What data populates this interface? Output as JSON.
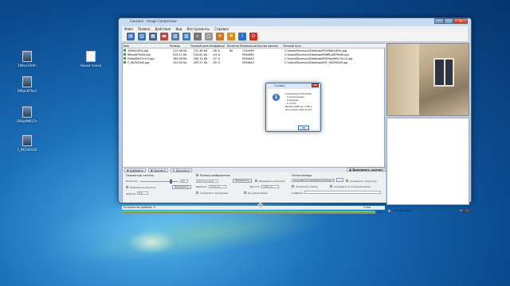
{
  "window": {
    "title": "Caesium - Image Compressor",
    "min_label": "–",
    "max_label": "□",
    "close_label": "✕"
  },
  "menu": [
    "Файл",
    "Правка",
    "Действие",
    "Вид",
    "Инструменты",
    "Справка"
  ],
  "toolbar_icons": [
    {
      "name": "open-icon",
      "color": "#3d6fb6",
      "glyph": "▤"
    },
    {
      "name": "folder-icon",
      "color": "#3d6fb6",
      "glyph": "▥"
    },
    {
      "name": "save-icon",
      "color": "#4a5f87",
      "glyph": "▦"
    },
    {
      "name": "remove-icon",
      "color": "#b94a48",
      "glyph": "▬"
    },
    {
      "name": "clear-icon",
      "color": "#5577aa",
      "glyph": "▧"
    },
    {
      "name": "export-icon",
      "color": "#3b7bbd",
      "glyph": "▨"
    },
    {
      "name": "search-icon",
      "color": "#777777",
      "glyph": "⌕"
    },
    {
      "name": "preview-icon",
      "color": "#999999",
      "glyph": "◻"
    },
    {
      "name": "tools-icon",
      "color": "#c27a2a",
      "glyph": "✕"
    },
    {
      "name": "gear-icon",
      "color": "#d88a1a",
      "glyph": "✲"
    },
    {
      "name": "info-icon",
      "color": "#2f6fc3",
      "glyph": "i"
    },
    {
      "name": "power-icon",
      "color": "#cc3322",
      "glyph": "⏻"
    }
  ],
  "table": {
    "headers": [
      "Имя",
      "Размер",
      "Полный разм",
      "Коэффици",
      "Качество",
      "Разрешение",
      "Кол-во цветов",
      "Полный путь"
    ],
    "rows": [
      {
        "name": "1Mike1St9n.jpg",
        "size": "213.06 Kb",
        "new": "131.36 Kb",
        "ratio": "-38 %",
        "q": "80",
        "res": "720x959",
        "colors": "",
        "path": "C:\\Users\\Roumuck\\Desktop\\fff\\1Mike1St9n.jpg"
      },
      {
        "name": "6fftyk87fksf0.jpg",
        "size": "414.11 Kb",
        "new": "233.81 Kb",
        "ratio": "-44 %",
        "q": "",
        "res": "959x640",
        "colors": "",
        "path": "C:\\Users\\Roumuck\\Desktop\\fff\\6fftyk87fksf0.jpg"
      },
      {
        "name": "D9ep9tN17ncrX.jpg",
        "size": "289.05 Kb",
        "new": "183.14 Kb",
        "ratio": "-37 %",
        "q": "",
        "res": "959x640",
        "colors": "",
        "path": "C:\\Users\\Roumuck\\Desktop\\fff\\D9ep9tN17ncrX.jpg"
      },
      {
        "name": "F_9K2940d5.jpg",
        "size": "413.05 Kb",
        "new": "267.57 Kb",
        "ratio": "-35 %",
        "q": "",
        "res": "959x640",
        "colors": "",
        "path": "C:\\Users\\Roumuck\\Desktop\\fff\\F_9K2940d5.jpg"
      }
    ]
  },
  "actions": {
    "add": "✚ Добавить",
    "remove": "✖ Удалить",
    "preview": "↻ Просмотр",
    "compress": "▣ Выполнить сжатие!"
  },
  "compression": {
    "section_title": "Параметры сжатия",
    "quality_label": "Качество:",
    "quality_value": "80",
    "apply_all_label": "Применить для всех",
    "apply_button": "Применить",
    "format_label": "Формат:",
    "format_value": "JPG"
  },
  "resize": {
    "section_title": "Размер изображения",
    "mode_value": "Абсолютный",
    "apply_button": "Применить",
    "apply_all_label": "Применить для всех",
    "width_label": "Ширина:",
    "width_value": "1900 px",
    "height_label": "Высота:",
    "height_value": "1080 px",
    "keep_ratio_label": "Сохранить пропорции",
    "no_enlarge_label": "Не увеличивать"
  },
  "output": {
    "section_title": "Папка вывода",
    "path_value": "\\Users\\Roumuck\\Desktop\\Новая папка",
    "browse_button": "...",
    "keep_structure_label": "Сохранить структуру",
    "remember_label": "Запомнить папку",
    "same_folder_label": "Сохранить в исходной папке",
    "suffix_label": "Суффикс:"
  },
  "status": {
    "file_count": "Количество файлов: 4",
    "progress_label": "100%",
    "progress_value": 1.0,
    "cancel_label": "Стоп"
  },
  "preview_controls": {
    "auto_preview_label": "Авто просмотр"
  },
  "dialog": {
    "title": "Готово!",
    "close_label": "✕",
    "icon_glyph": "i",
    "lines": [
      "Compression finished!",
      "- 4 compressed",
      "- 0 skipped",
      "- 0 errors",
      "Время работы: 0.85 s",
      "Экономия: 462.41 Kb"
    ],
    "ok_label": "OK"
  },
  "desktop_icons": [
    {
      "label": "1Mike1St9n",
      "type": "photo"
    },
    {
      "label": "Новая папка",
      "type": "folder"
    },
    {
      "label": "6fftyk87fksf",
      "type": "photo"
    },
    {
      "label": "D9ep9tN17n",
      "type": "photo"
    },
    {
      "label": "F_9K2940d5",
      "type": "photo"
    }
  ]
}
